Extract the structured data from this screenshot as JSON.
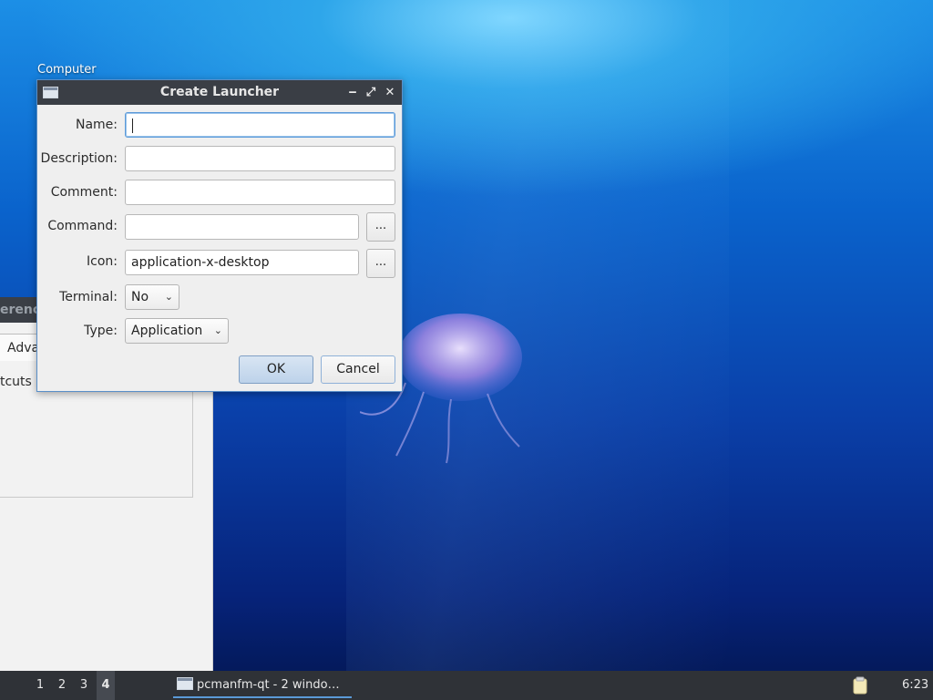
{
  "desktop": {
    "icon_label": "Computer"
  },
  "background_window": {
    "title_fragment": "erenc",
    "tab_fragment": "Adva",
    "shortcuts_fragment": "tcuts"
  },
  "dialog": {
    "title": "Create Launcher",
    "buttons": {
      "minimize": "‒",
      "maximize": "⤢",
      "close": "✕"
    },
    "fields": {
      "name": {
        "label": "Name:",
        "value": ""
      },
      "description": {
        "label": "Description:",
        "value": ""
      },
      "comment": {
        "label": "Comment:",
        "value": ""
      },
      "command": {
        "label": "Command:",
        "value": "",
        "browse_label": "..."
      },
      "icon": {
        "label": "Icon:",
        "value": "application-x-desktop",
        "browse_label": "..."
      },
      "terminal": {
        "label": "Terminal:",
        "selected": "No"
      },
      "type": {
        "label": "Type:",
        "selected": "Application"
      }
    },
    "ok_label": "OK",
    "cancel_label": "Cancel"
  },
  "taskbar": {
    "workspaces": [
      "1",
      "2",
      "3",
      "4"
    ],
    "active_workspace": "4",
    "task_label": "pcmanfm-qt - 2 windo…",
    "clock": "6:23"
  },
  "colors": {
    "accent": "#5b9ad9",
    "titlebar": "#3a3e45",
    "taskbar": "#2f3237"
  }
}
